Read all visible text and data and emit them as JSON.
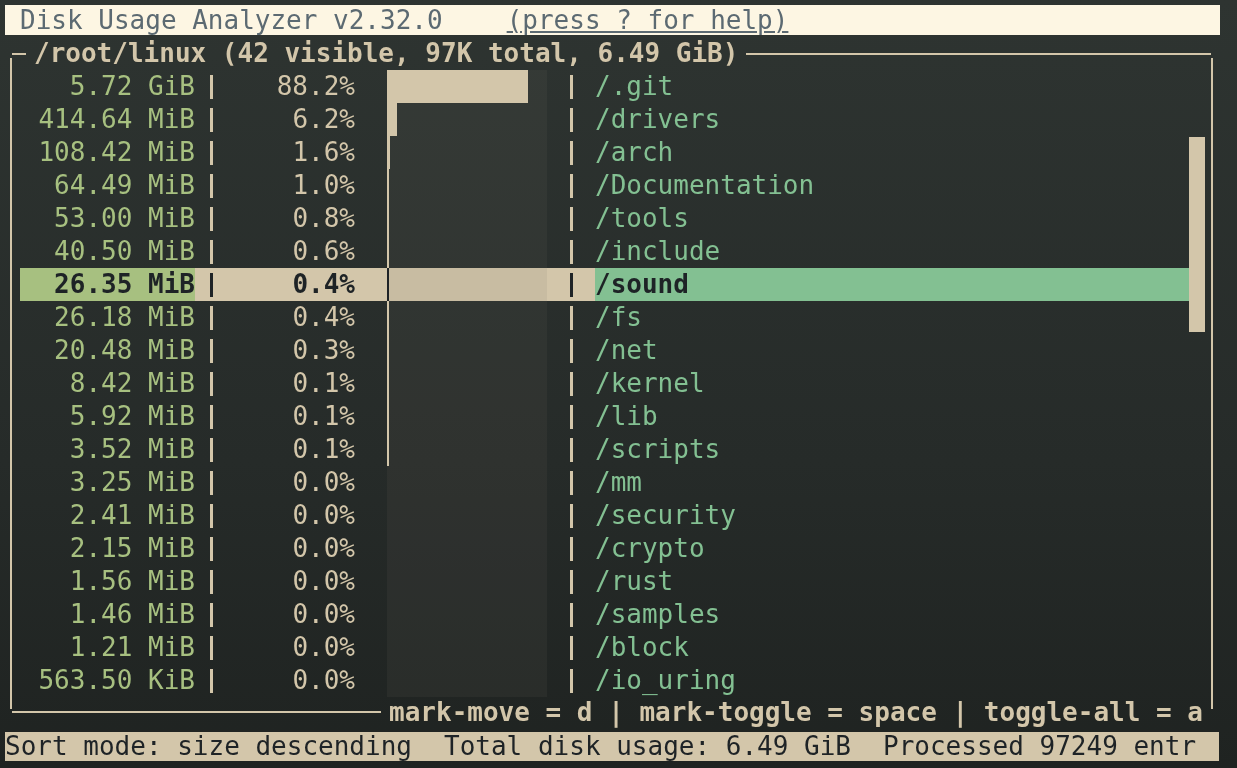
{
  "title_bar": {
    "title": "Disk Usage Analyzer v2.32.0",
    "help": "(press ? for help)"
  },
  "panel": {
    "title": "/root/linux (42 visible, 97K total, 6.49 GiB)",
    "rows": [
      {
        "size": "5.72 GiB",
        "percent": "88.2%",
        "level": 0.882,
        "name": "/.git",
        "selected": false
      },
      {
        "size": "414.64 MiB",
        "percent": "6.2%",
        "level": 0.062,
        "name": "/drivers",
        "selected": false
      },
      {
        "size": "108.42 MiB",
        "percent": "1.6%",
        "level": 0.016,
        "name": "/arch",
        "selected": false
      },
      {
        "size": "64.49 MiB",
        "percent": "1.0%",
        "level": 0.01,
        "name": "/Documentation",
        "selected": false
      },
      {
        "size": "53.00 MiB",
        "percent": "0.8%",
        "level": 0.008,
        "name": "/tools",
        "selected": false
      },
      {
        "size": "40.50 MiB",
        "percent": "0.6%",
        "level": 0.006,
        "name": "/include",
        "selected": false
      },
      {
        "size": "26.35 MiB",
        "percent": "0.4%",
        "level": 0.004,
        "name": "/sound",
        "selected": true
      },
      {
        "size": "26.18 MiB",
        "percent": "0.4%",
        "level": 0.004,
        "name": "/fs",
        "selected": false
      },
      {
        "size": "20.48 MiB",
        "percent": "0.3%",
        "level": 0.003,
        "name": "/net",
        "selected": false
      },
      {
        "size": "8.42 MiB",
        "percent": "0.1%",
        "level": 0.001,
        "name": "/kernel",
        "selected": false
      },
      {
        "size": "5.92 MiB",
        "percent": "0.1%",
        "level": 0.001,
        "name": "/lib",
        "selected": false
      },
      {
        "size": "3.52 MiB",
        "percent": "0.1%",
        "level": 0.001,
        "name": "/scripts",
        "selected": false
      },
      {
        "size": "3.25 MiB",
        "percent": "0.0%",
        "name": "/mm",
        "selected": false
      },
      {
        "size": "2.41 MiB",
        "percent": "0.0%",
        "name": "/security",
        "selected": false
      },
      {
        "size": "2.15 MiB",
        "percent": "0.0%",
        "name": "/crypto",
        "selected": false
      },
      {
        "size": "1.56 MiB",
        "percent": "0.0%",
        "name": "/rust",
        "selected": false
      },
      {
        "size": "1.46 MiB",
        "percent": "0.0%",
        "name": "/samples",
        "selected": false
      },
      {
        "size": "1.21 MiB",
        "percent": "0.0%",
        "name": "/block",
        "selected": false
      },
      {
        "size": "563.50 KiB",
        "percent": "0.0%",
        "name": "/io_uring",
        "selected": false
      }
    ],
    "hints": "mark-move = d | mark-toggle = space | toggle-all = a"
  },
  "status_bar": [
    "Sort mode: size descending",
    "Total disk usage: 6.49 GiB",
    "Processed 97249 entr"
  ]
}
